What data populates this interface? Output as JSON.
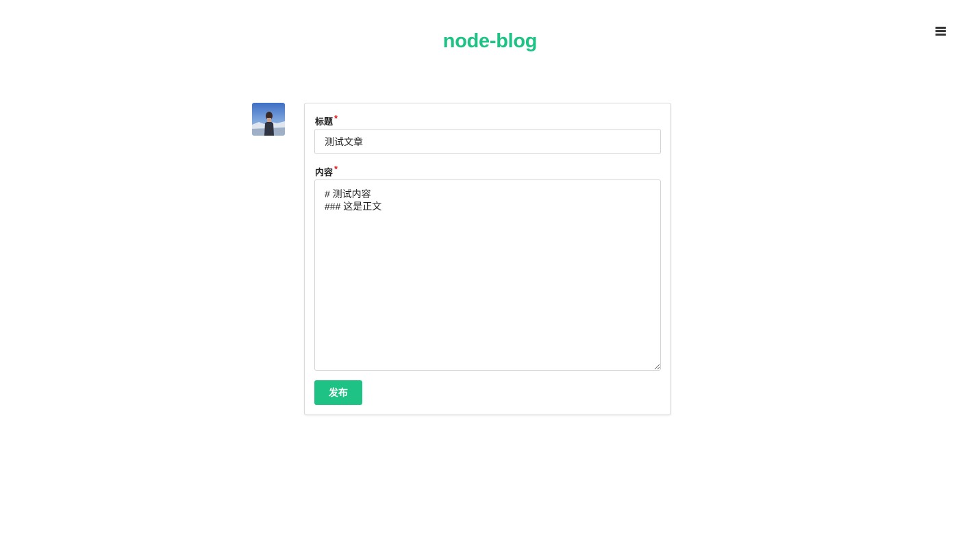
{
  "header": {
    "site_title": "node-blog",
    "menu_icon": "hamburger-menu-icon"
  },
  "user": {
    "avatar_icon": "user-avatar-photo"
  },
  "form": {
    "title_label": "标题",
    "title_required_mark": "*",
    "title_value": "测试文章",
    "content_label": "内容",
    "content_required_mark": "*",
    "content_value": "# 测试内容\n### 这是正文",
    "submit_label": "发布"
  },
  "colors": {
    "brand": "#1fc285",
    "required": "#e0161c",
    "border": "#d4d4d5"
  }
}
